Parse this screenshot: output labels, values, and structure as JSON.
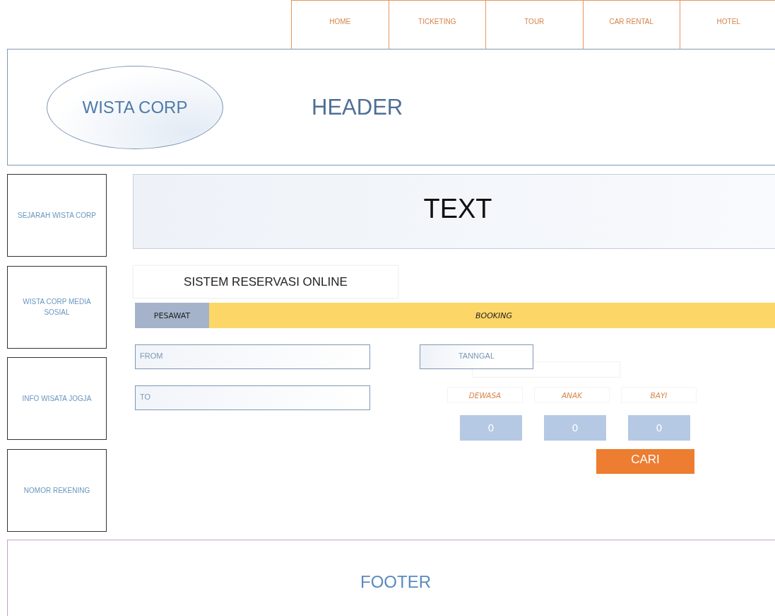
{
  "nav": [
    "HOME",
    "TICKETING",
    "TOUR",
    "CAR RENTAL",
    "HOTEL"
  ],
  "header": {
    "logo": "WISTA CORP",
    "title": "HEADER"
  },
  "sidebar": [
    "SEJARAH WISTA CORP",
    "WISTA CORP MEDIA SOSIAL",
    "INFO WISATA JOGJA",
    "NOMOR REKENING"
  ],
  "banner": "TEXT",
  "reservation": {
    "title": "SISTEM RESERVASI ONLINE",
    "tab": "PESAWAT",
    "bar_label": "BOOKING",
    "from": {
      "placeholder": "FROM"
    },
    "to": {
      "placeholder": "TO"
    },
    "date": {
      "placeholder": "TANNGAL"
    },
    "passengers": [
      {
        "label": "DEWASA",
        "value": "0"
      },
      {
        "label": "ANAK",
        "value": "0"
      },
      {
        "label": "BAYI",
        "value": "0"
      }
    ],
    "search_button": "CARI"
  },
  "footer": "FOOTER"
}
